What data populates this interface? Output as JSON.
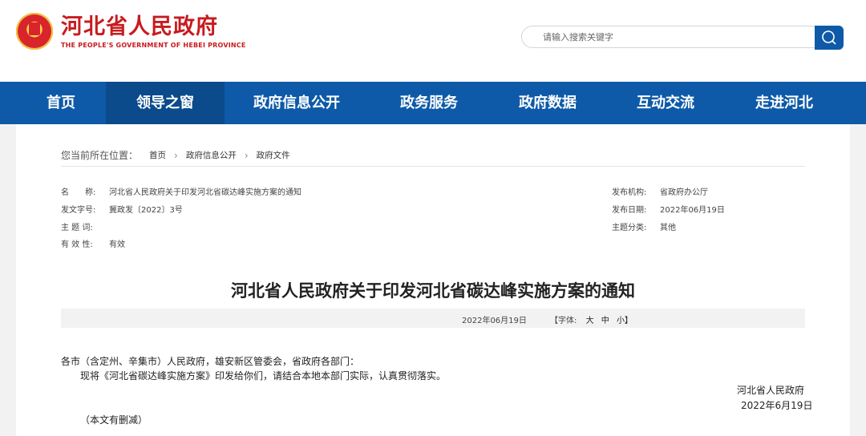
{
  "header": {
    "site_name": "河北省人民政府",
    "site_name_en": "THE PEOPLE'S GOVERNMENT OF HEBEI PROVINCE",
    "search_placeholder": "请输入搜索关键字",
    "brand_color": "#c81b1f",
    "primary_color": "#0e5aa8"
  },
  "nav": {
    "items": [
      {
        "label": "首页",
        "active": false
      },
      {
        "label": "领导之窗",
        "active": true
      },
      {
        "label": "政府信息公开",
        "active": false
      },
      {
        "label": "政务服务",
        "active": false
      },
      {
        "label": "政府数据",
        "active": false
      },
      {
        "label": "互动交流",
        "active": false
      },
      {
        "label": "走进河北",
        "active": false
      }
    ]
  },
  "breadcrumb": {
    "label": "您当前所在位置：",
    "items": [
      "首页",
      "政府信息公开",
      "政府文件"
    ]
  },
  "meta": {
    "name_key": "名　　称:",
    "name_value": "河北省人民政府关于印发河北省碳达峰实施方案的通知",
    "docno_key": "发文字号:",
    "docno_value": "冀政发〔2022〕3号",
    "subject_key": "主  题  词:",
    "subject_value": "",
    "validity_key": "有  效  性:",
    "validity_value": "有效",
    "publisher_key": "发布机构:",
    "publisher_value": "省政府办公厅",
    "date_key": "发布日期:",
    "date_value": "2022年06月19日",
    "category_key": "主题分类:",
    "category_value": "其他"
  },
  "document": {
    "title": "河北省人民政府关于印发河北省碳达峰实施方案的通知",
    "date": "2022年06月19日",
    "font_label": "【字体:",
    "font_large": "大",
    "font_medium": "中",
    "font_small": "小】",
    "salutation": "各市（含定州、辛集市）人民政府，雄安新区管委会，省政府各部门：",
    "paragraph": "现将《河北省碳达峰实施方案》印发给你们，请结合本地本部门实际，认真贯彻落实。",
    "signature": "河北省人民政府",
    "signature_date": "2022年6月19日",
    "note": "（本文有删减）"
  }
}
